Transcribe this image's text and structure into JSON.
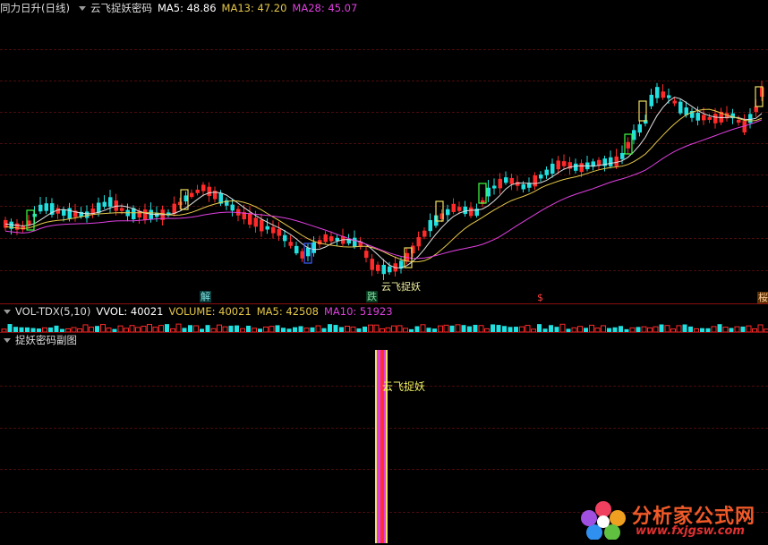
{
  "main_header": {
    "stock_name": "同力日升(日线)",
    "indicator_name": "云飞捉妖密码",
    "ma5": "MA5: 48.86",
    "ma13": "MA13: 47.20",
    "ma28": "MA28: 45.07"
  },
  "volume_header": {
    "indicator": "VOL-TDX(5,10)",
    "vvol": "VVOL: 40021",
    "volume": "VOLUME: 40021",
    "ma5": "MA5: 42508",
    "ma10": "MA10: 51923"
  },
  "sub_header": {
    "title": "捉妖密码副图"
  },
  "chart_labels": {
    "jie": "解",
    "die": "跌",
    "yunfei_main": "云飞捉妖",
    "dollar": "$",
    "right_edge": "桜",
    "yunfei_sub": "云飞捉妖"
  },
  "watermark": {
    "text": "分析家公式网",
    "url": "www.fxjgsw.com"
  },
  "colors": {
    "up": "#ff2a2a",
    "down": "#22e0e0",
    "ma5": "#e0e0e0",
    "ma13": "#e6c84a",
    "ma28": "#e040e0",
    "grid": "#4a0c0c",
    "separator": "#8a1010"
  },
  "icons": {
    "collapse": "triangle-down-icon"
  }
}
